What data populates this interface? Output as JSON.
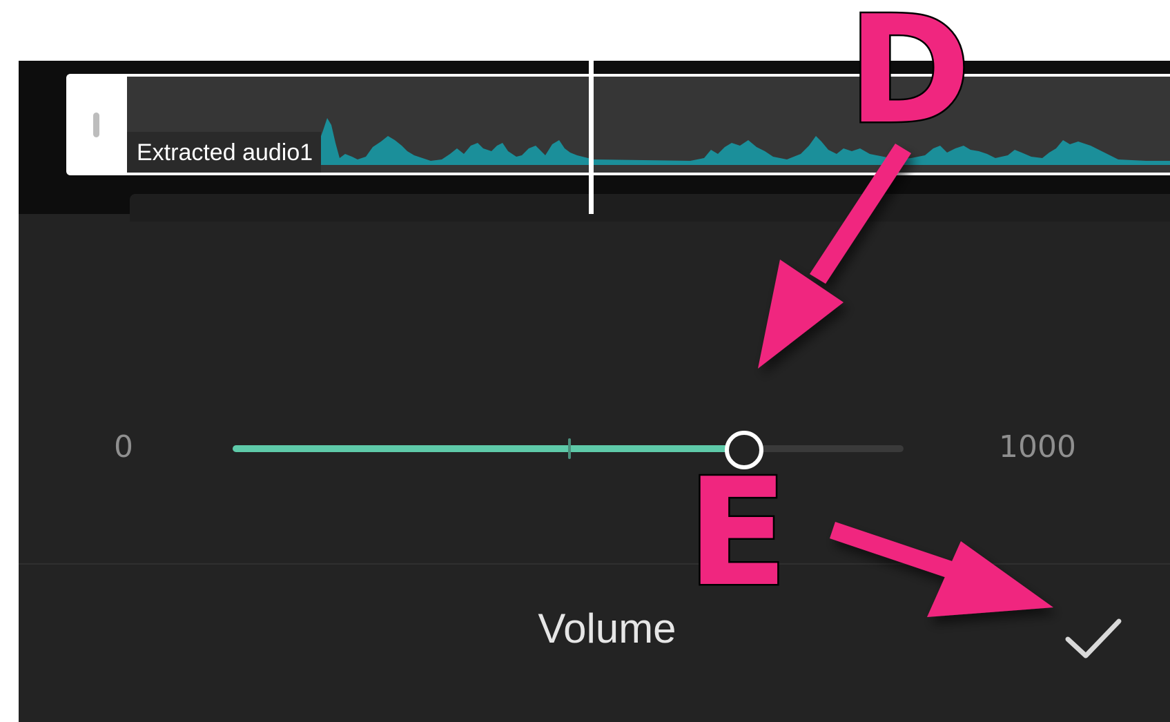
{
  "timeline": {
    "clip_label": "Extracted audio1"
  },
  "volume_slider": {
    "min_label": "0",
    "max_label": "1000",
    "value_fraction": 0.76,
    "tick_fraction": 0.5,
    "track_color": "#3a3a3a",
    "fill_color": "#5ecaa9"
  },
  "panel": {
    "title": "Volume",
    "confirm_icon": "checkmark-icon"
  },
  "annotations": {
    "marker_d": "D",
    "marker_e": "E",
    "color": "#f0267f"
  }
}
